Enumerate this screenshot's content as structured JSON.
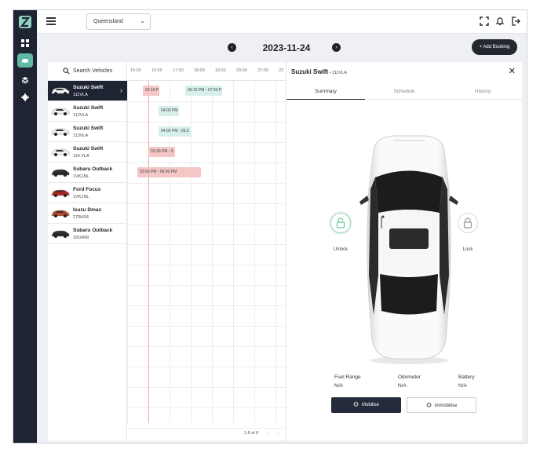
{
  "topbar": {
    "region": "Queensland"
  },
  "date_nav": {
    "date": "2023-11-24"
  },
  "add_booking_label": "+ Add Booking",
  "search": {
    "placeholder": "Search Vehicles"
  },
  "timeline": {
    "ticks": [
      "15:00",
      "16:00",
      "17:00",
      "18:00",
      "19:00",
      "20:00",
      "21:00",
      "22"
    ]
  },
  "vehicles": [
    {
      "name": "Suzuki Swift",
      "plate": "111VLA",
      "color": "#f2f2f2",
      "selected": true
    },
    {
      "name": "Suzuki Swift",
      "plate": "112VLA",
      "color": "#f2f2f2"
    },
    {
      "name": "Suzuki Swift",
      "plate": "113VLA",
      "color": "#f2f2f2"
    },
    {
      "name": "Suzuki Swift",
      "plate": "114 VLA",
      "color": "#f2f2f2"
    },
    {
      "name": "Subaru Outback",
      "plate": "1VK1NL",
      "color": "#2a2a2a"
    },
    {
      "name": "Ford Focus",
      "plate": "1VK1NL",
      "color": "#b3261e"
    },
    {
      "name": "Isuzu Dmax",
      "plate": "275HS4",
      "color": "#b84a2a"
    },
    {
      "name": "Subaru Outback",
      "plate": "181HN9",
      "color": "#2a2a2a"
    }
  ],
  "bookings": [
    {
      "row": 0,
      "label": "03:15 P",
      "style": "red"
    },
    {
      "row": 0,
      "label": "05:15 PM - 07:00 P",
      "style": "teal"
    },
    {
      "row": 1,
      "label": "04:00 PM",
      "style": "teal"
    },
    {
      "row": 2,
      "label": "04:00 PM - 05:3",
      "style": "teal"
    },
    {
      "row": 3,
      "label": "03:30 PM - 0",
      "style": "red"
    },
    {
      "row": 4,
      "label": "03:00 PM - 06:00 PM",
      "style": "red"
    }
  ],
  "pager": {
    "text": "1-8 of 8",
    "prev": "‹",
    "next": "›"
  },
  "detail": {
    "title": "Suzuki Swift",
    "subtitle": " • 111VLA",
    "close": "✕",
    "tabs": [
      "Summary",
      "Schedule",
      "History"
    ],
    "unlock_label": "Unlock",
    "lock_label": "Lock",
    "stats": [
      {
        "label": "Fuel Range",
        "value": "N/A"
      },
      {
        "label": "Odometer",
        "value": "N/A"
      },
      {
        "label": "Battery",
        "value": "N/A"
      }
    ],
    "mobilise_label": "Mobilise",
    "immobilise_label": "Immobilise"
  },
  "colors": {
    "sidebar": "#1f2433",
    "accent": "#5fb9a4",
    "booking_red": "#f4c6c6",
    "booking_teal": "#d7efeb"
  }
}
